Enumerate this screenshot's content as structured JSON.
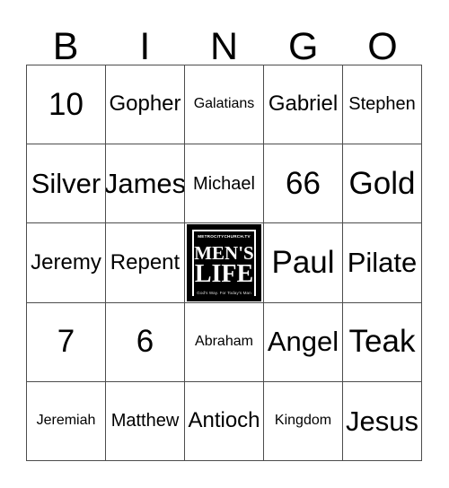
{
  "card": {
    "header_letters": [
      "B",
      "I",
      "N",
      "G",
      "O"
    ],
    "free_space_position": {
      "row": 2,
      "col": 2
    },
    "grid": [
      [
        {
          "text": "10",
          "size": "xl"
        },
        {
          "text": "Gopher",
          "size": "md"
        },
        {
          "text": "Galatians",
          "size": "xs"
        },
        {
          "text": "Gabriel",
          "size": "md"
        },
        {
          "text": "Stephen",
          "size": "sm"
        }
      ],
      [
        {
          "text": "Silver",
          "size": "lg"
        },
        {
          "text": "James",
          "size": "lg"
        },
        {
          "text": "Michael",
          "size": "sm"
        },
        {
          "text": "66",
          "size": "xl"
        },
        {
          "text": "Gold",
          "size": "xl"
        }
      ],
      [
        {
          "text": "Jeremy",
          "size": "md"
        },
        {
          "text": "Repent",
          "size": "md"
        },
        {
          "text": "",
          "size": "free"
        },
        {
          "text": "Paul",
          "size": "xl"
        },
        {
          "text": "Pilate",
          "size": "lg"
        }
      ],
      [
        {
          "text": "7",
          "size": "xl"
        },
        {
          "text": "6",
          "size": "xl"
        },
        {
          "text": "Abraham",
          "size": "xs"
        },
        {
          "text": "Angel",
          "size": "lg"
        },
        {
          "text": "Teak",
          "size": "xl"
        }
      ],
      [
        {
          "text": "Jeremiah",
          "size": "xs"
        },
        {
          "text": "Matthew",
          "size": "sm"
        },
        {
          "text": "Antioch",
          "size": "md"
        },
        {
          "text": "Kingdom",
          "size": "xs"
        },
        {
          "text": "Jesus",
          "size": "lg"
        }
      ]
    ]
  },
  "free_space_logo": {
    "top_text": "METROCITYCHURCH.TV",
    "word_one": "MEN'S",
    "word_two": "LIFE",
    "tagline": "God's Way. For Today's Man",
    "background_color": "#000000",
    "text_color": "#ffffff"
  },
  "colors": {
    "page_background": "#ffffff",
    "grid_line": "#4d4d4d",
    "text": "#000000"
  }
}
